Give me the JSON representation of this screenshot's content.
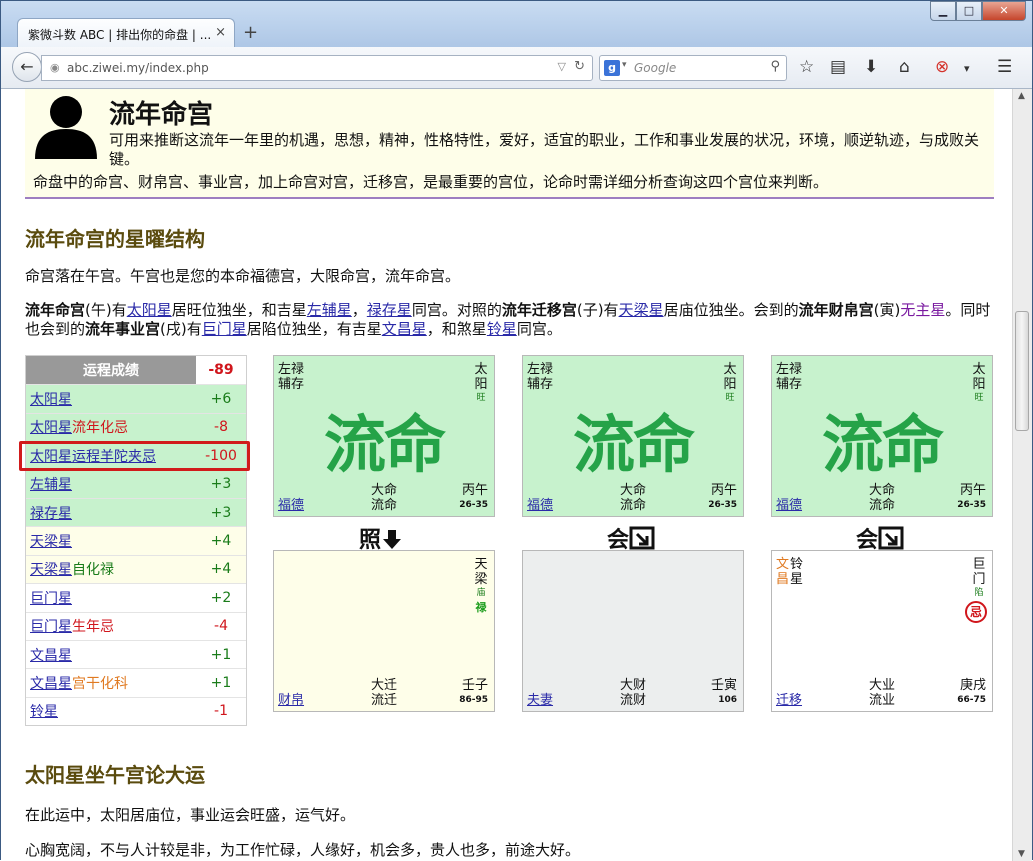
{
  "browser": {
    "tab_title": "紫微斗数 ABC | 排出你的命盘 | ...",
    "tab_close": "×",
    "new_tab": "+",
    "url": "abc.ziwei.my/index.php",
    "search_placeholder": "Google",
    "search_engine": "g"
  },
  "header": {
    "title": "流年命宫",
    "desc": "可用来推断这流年一年里的机遇，思想，精神，性格特性，爱好，适宜的职业，工作和事业发展的状况，环境，顺逆轨迹，与成败关键。",
    "desc2": "命盘中的命宫、财帛宫、事业宫，加上命宫对宫，迁移宫，是最重要的宫位，论命时需详细分析查询这四个宫位来判断。"
  },
  "section1": {
    "heading": "流年命宫的星曜结构",
    "p1": "命宫落在午宫。午宫也是您的本命福德宫，大限命宫，流年命宫。",
    "p2": {
      "t1": "流年命宫",
      "t2": "(午)有",
      "t3": "太阳星",
      "t4": "居旺位独坐，和吉星",
      "t5": "左辅星",
      "t6": "，",
      "t7": "禄存星",
      "t8": "同宫。对照的",
      "t9": "流年迁移宫",
      "t10": "(子)有",
      "t11": "天梁星",
      "t12": "居庙位独坐。会到的",
      "t13": "流年财帛宫",
      "t14": "(寅)",
      "t15": "无主星",
      "t16": "。同时也会到的",
      "t17": "流年事业宫",
      "t18": "(戌)有",
      "t19": "巨门星",
      "t20": "居陷位独坐，有吉星",
      "t21": "文昌星",
      "t22": "，和煞星",
      "t23": "铃星",
      "t24": "同宫。"
    }
  },
  "score": {
    "header": "运程成绩",
    "total": "-89",
    "rows": [
      {
        "name": "太阳星",
        "suffix": "",
        "value": "+6"
      },
      {
        "name": "太阳星",
        "suffix": "流年化忌",
        "value": "-8"
      },
      {
        "name": "太阳星",
        "suffix": "运程羊陀夹忌",
        "value": "-100"
      },
      {
        "name": "左辅星",
        "suffix": "",
        "value": "+3"
      },
      {
        "name": "禄存星",
        "suffix": "",
        "value": "+3"
      },
      {
        "name": "天梁星",
        "suffix": "",
        "value": "+4"
      },
      {
        "name": "天梁星",
        "suffix": "自化禄",
        "value": "+4"
      },
      {
        "name": "巨门星",
        "suffix": "",
        "value": "+2"
      },
      {
        "name": "巨门星",
        "suffix": "生年忌",
        "value": "-4"
      },
      {
        "name": "文昌星",
        "suffix": "",
        "value": "+1"
      },
      {
        "name": "文昌星",
        "suffix": "宫干化科",
        "value": "+1"
      },
      {
        "name": "铃星",
        "suffix": "",
        "value": "-1"
      }
    ]
  },
  "chart": {
    "top": {
      "stars_l1": "左禄",
      "stars_l2": "辅存",
      "main": "太阳",
      "state": "旺",
      "big": "流命",
      "palace": "福德",
      "lim1": "大命",
      "lim2": "流命",
      "gz": "丙午",
      "age": "26-35"
    },
    "connectors": [
      "照",
      "会",
      "会"
    ],
    "arrows": [
      "down-arrow-icon",
      "diagonal-arrow-icon"
    ],
    "b1": {
      "main": "天梁",
      "state": "庙",
      "hua": "禄",
      "palace": "财帛",
      "lim1": "大迁",
      "lim2": "流迁",
      "gz": "壬子",
      "age": "86-95"
    },
    "b2": {
      "palace": "夫妻",
      "lim1": "大财",
      "lim2": "流财",
      "gz": "壬寅",
      "age": "106"
    },
    "b3": {
      "s1a": "文",
      "s1b": "昌",
      "s2a": "铃",
      "s2b": "星",
      "main": "巨门",
      "state": "陷",
      "ji": "忌",
      "palace": "迁移",
      "lim1": "大业",
      "lim2": "流业",
      "gz": "庚戌",
      "age": "66-75"
    }
  },
  "section2": {
    "heading": "太阳星坐午宫论大运",
    "p1": "在此运中，太阳居庙位，事业运会旺盛，运气好。",
    "p2": "心胸宽阔，不与人计较是非，为工作忙碌，人缘好，机会多，贵人也多，前途大好。"
  }
}
